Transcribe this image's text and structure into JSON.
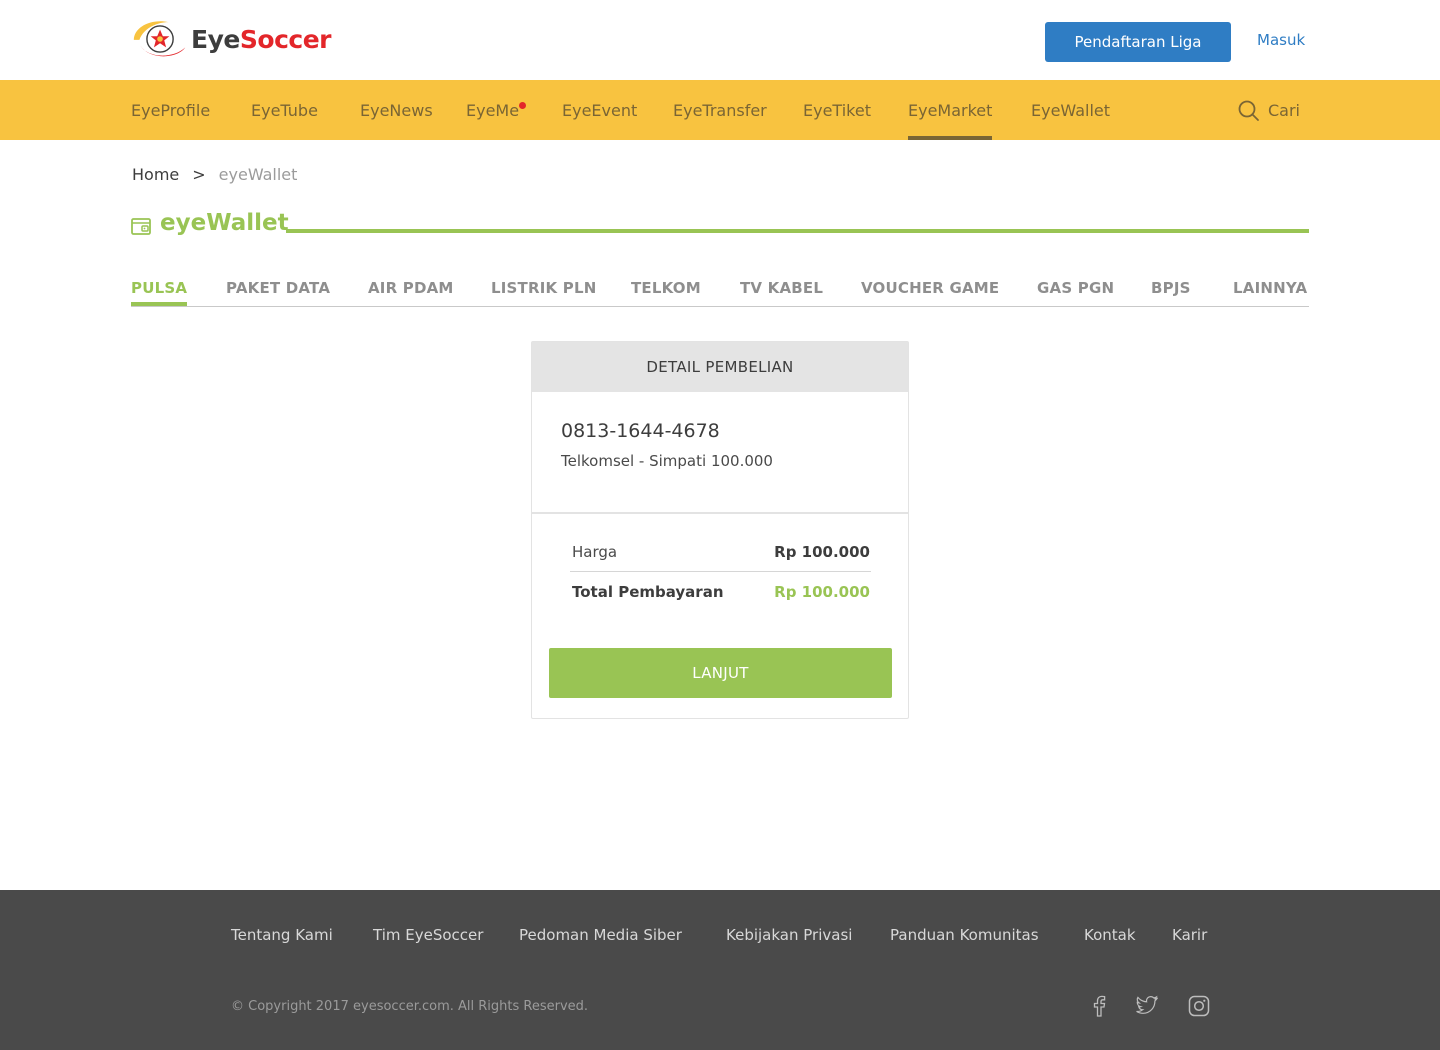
{
  "header": {
    "logo_eye": "Eye",
    "logo_soccer": "Soccer",
    "register_label": "Pendaftaran Liga",
    "login_label": "Masuk"
  },
  "nav": {
    "items": [
      {
        "label": "EyeProfile"
      },
      {
        "label": "EyeTube"
      },
      {
        "label": "EyeNews"
      },
      {
        "label": "EyeMe"
      },
      {
        "label": "EyeEvent"
      },
      {
        "label": "EyeTransfer"
      },
      {
        "label": "EyeTiket"
      },
      {
        "label": "EyeMarket",
        "active": true
      },
      {
        "label": "EyeWallet"
      }
    ],
    "search_label": "Cari"
  },
  "breadcrumb": {
    "home": "Home",
    "separator": ">",
    "current": "eyeWallet"
  },
  "page": {
    "title": "eyeWallet"
  },
  "tabs": [
    {
      "label": "PULSA",
      "active": true
    },
    {
      "label": "PAKET DATA"
    },
    {
      "label": "AIR PDAM"
    },
    {
      "label": "LISTRIK PLN"
    },
    {
      "label": "TELKOM"
    },
    {
      "label": "TV KABEL"
    },
    {
      "label": "VOUCHER GAME"
    },
    {
      "label": "GAS PGN"
    },
    {
      "label": "BPJS"
    },
    {
      "label": "LAINNYA"
    }
  ],
  "detail": {
    "heading": "DETAIL PEMBELIAN",
    "phone": "0813-1644-4678",
    "product": "Telkomsel - Simpati 100.000",
    "price_label": "Harga",
    "price_value": "Rp 100.000",
    "total_label": "Total Pembayaran",
    "total_value": "Rp 100.000",
    "next_label": "LANJUT"
  },
  "footer": {
    "links": [
      {
        "label": "Tentang Kami"
      },
      {
        "label": "Tim EyeSoccer"
      },
      {
        "label": "Pedoman Media Siber"
      },
      {
        "label": "Kebijakan Privasi"
      },
      {
        "label": "Panduan Komunitas"
      },
      {
        "label": "Kontak"
      },
      {
        "label": "Karir"
      }
    ],
    "copyright": "© Copyright 2017 eyesoccer.com. All Rights Reserved.",
    "social": [
      "facebook-icon",
      "twitter-icon",
      "instagram-icon"
    ]
  },
  "colors": {
    "brand_yellow": "#f8c340",
    "brand_green": "#99c454",
    "brand_blue": "#2f7dc4",
    "brand_red": "#e3262a",
    "footer_bg": "#4a4a4a"
  }
}
